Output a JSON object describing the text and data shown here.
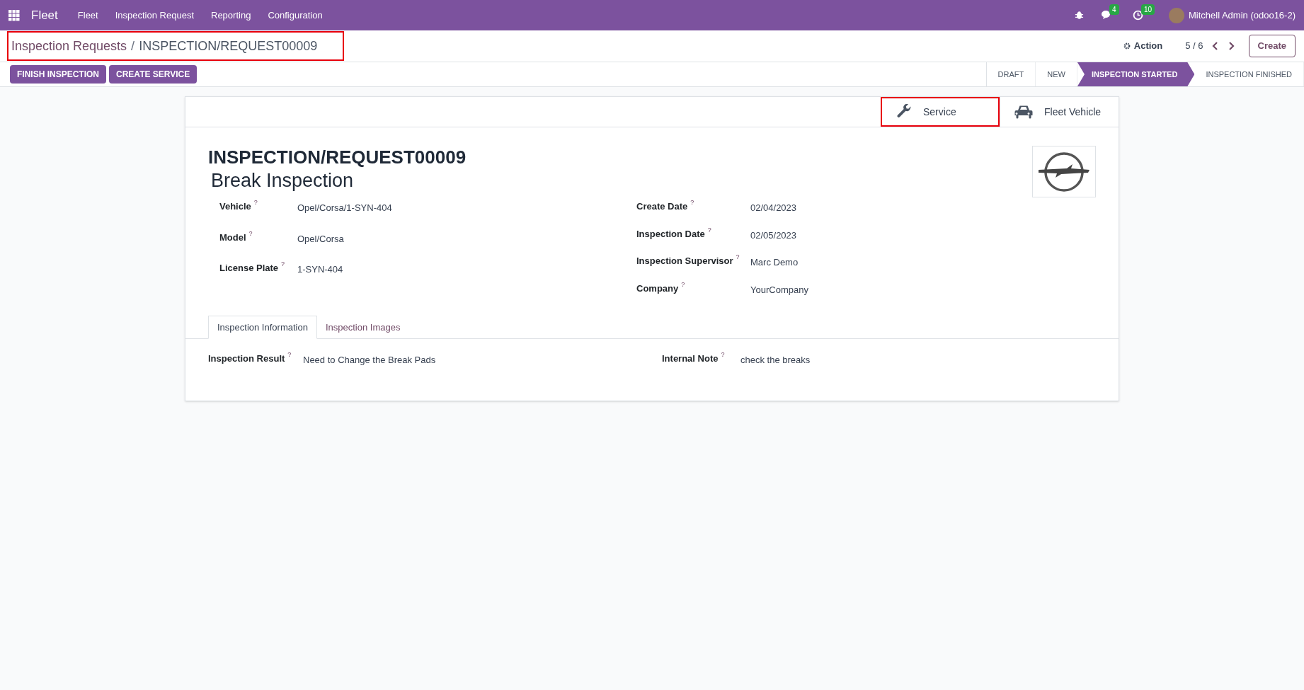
{
  "navbar": {
    "app": "Fleet",
    "menu": [
      "Fleet",
      "Inspection Request",
      "Reporting",
      "Configuration"
    ],
    "messages_count": "4",
    "activities_count": "10",
    "user": "Mitchell Admin (odoo16-2)"
  },
  "breadcrumb": {
    "parent": "Inspection Requests",
    "separator": "/",
    "current": "INSPECTION/REQUEST00009",
    "highlighted": true
  },
  "control": {
    "action": "Action",
    "pager": "5 / 6",
    "create": "Create"
  },
  "buttons": [
    "FINISH INSPECTION",
    "CREATE SERVICE"
  ],
  "stages": [
    {
      "label": "DRAFT",
      "selected": false
    },
    {
      "label": "NEW",
      "selected": false
    },
    {
      "label": "INSPECTION STARTED",
      "selected": true
    },
    {
      "label": "INSPECTION FINISHED",
      "selected": false
    }
  ],
  "smart_buttons": [
    {
      "kind": "wrench",
      "label": "Service",
      "highlighted": true
    },
    {
      "kind": "car",
      "label": "Fleet Vehicle",
      "highlighted": false
    }
  ],
  "record": {
    "name": "INSPECTION/REQUEST00009",
    "title": "Break Inspection"
  },
  "left_fields": [
    {
      "label": "Vehicle",
      "help": "?",
      "value": "Opel/Corsa/1-SYN-404"
    },
    {
      "label": "Model",
      "help": "?",
      "value": "Opel/Corsa"
    },
    {
      "label": "License Plate",
      "help": "?",
      "value": "1-SYN-404"
    }
  ],
  "right_fields": [
    {
      "label": "Create Date",
      "help": "?",
      "value": "02/04/2023"
    },
    {
      "label": "Inspection Date",
      "help": "?",
      "value": "02/05/2023"
    },
    {
      "label": "Inspection Supervisor",
      "help": "?",
      "value": "Marc Demo"
    },
    {
      "label": "Company",
      "help": "?",
      "value": "YourCompany"
    }
  ],
  "tabs": [
    {
      "label": "Inspection Information",
      "selected": true
    },
    {
      "label": "Inspection Images",
      "selected": false
    }
  ],
  "tab_fields": [
    {
      "label": "Inspection Result",
      "help": "?",
      "value": "Need to Change the Break Pads"
    },
    {
      "label": "Internal Note",
      "help": "?",
      "value": "check the breaks"
    }
  ]
}
